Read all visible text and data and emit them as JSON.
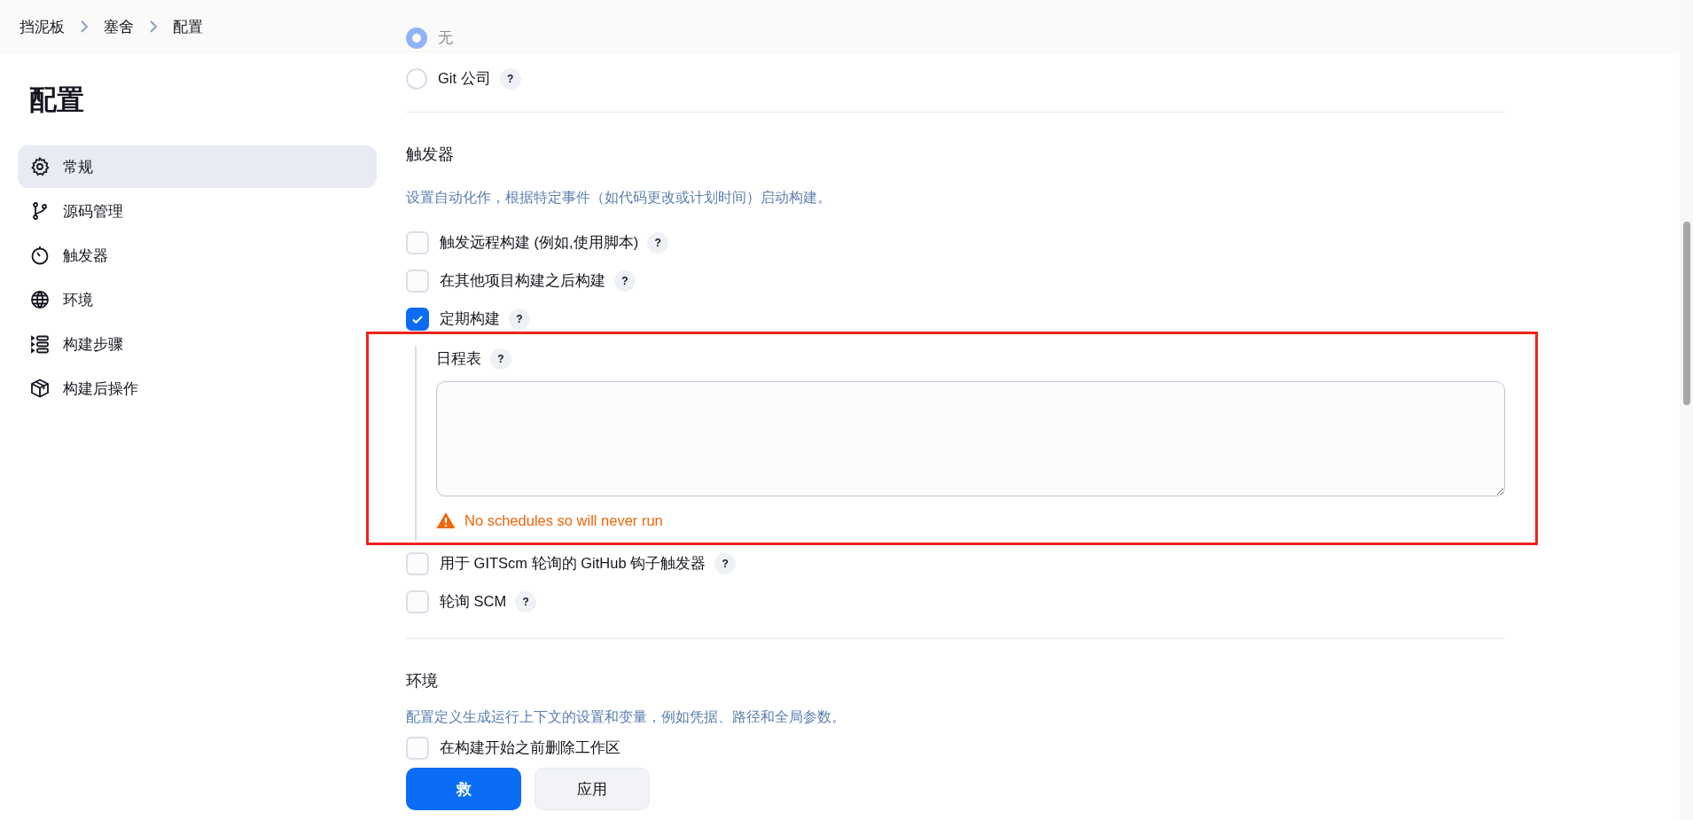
{
  "breadcrumbs": [
    {
      "label": "挡泥板"
    },
    {
      "label": "塞舍"
    },
    {
      "label": "配置"
    }
  ],
  "sidebar": {
    "title": "配置",
    "items": [
      {
        "label": "常规",
        "selected": true
      },
      {
        "label": "源码管理",
        "selected": false
      },
      {
        "label": "触发器",
        "selected": false
      },
      {
        "label": "环境",
        "selected": false
      },
      {
        "label": "构建步骤",
        "selected": false
      },
      {
        "label": "构建后操作",
        "selected": false
      }
    ]
  },
  "scm_options": [
    {
      "label": "无",
      "selected": true
    },
    {
      "label": "Git 公司",
      "selected": false,
      "help": "?"
    }
  ],
  "triggers": {
    "title": "触发器",
    "description": "设置自动化作，根据特定事件（如代码更改或计划时间）启动构建。",
    "options": [
      {
        "label": "触发远程构建 (例如,使用脚本)",
        "checked": false,
        "help": "?"
      },
      {
        "label": "在其他项目构建之后构建",
        "checked": false,
        "help": "?"
      },
      {
        "label": "定期构建",
        "checked": true,
        "help": "?",
        "schedule": {
          "label": "日程表",
          "help": "?",
          "warning": "No schedules so will never run"
        }
      },
      {
        "label": "用于 GITScm 轮询的 GitHub 钩子触发器",
        "checked": false,
        "help": "?"
      },
      {
        "label": "轮询 SCM",
        "checked": false,
        "help": "?"
      }
    ]
  },
  "environment": {
    "title": "环境",
    "description": "配置定义生成运行上下文的设置和变量，例如凭据、路径和全局参数。",
    "options": [
      {
        "label": "在构建开始之前删除工作区",
        "checked": false
      }
    ]
  },
  "buttons": [
    {
      "label": "救",
      "kind": "primary"
    },
    {
      "label": "应用",
      "kind": "secondary"
    }
  ]
}
